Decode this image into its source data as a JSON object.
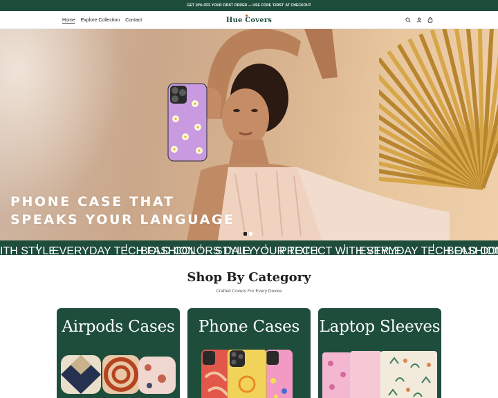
{
  "announcement": {
    "text": "GET 10% OFF YOUR FIRST ORDER — USE CODE 'FIRST' AT CHECKOUT"
  },
  "header": {
    "nav": [
      {
        "label": "Home",
        "active": true
      },
      {
        "label": "Explore Collection",
        "active": false
      },
      {
        "label": "Contact",
        "active": false
      }
    ],
    "logo": "Hue Covers",
    "icons": [
      "search-icon",
      "account-icon",
      "cart-icon"
    ]
  },
  "hero": {
    "title_line1": "PHONE CASE THAT",
    "title_line2": "SPEAKS YOUR LANGUAGE",
    "slides_total": 2,
    "active_slide": 1
  },
  "marquee": {
    "items": [
      "ITH STYLE",
      "EVERYDAY TECH FASHION",
      "BOLD COLORS DAILY",
      "STYLE YOUR TECH",
      "PROTECT WITH STYLE",
      "EVERYDAY TECH FASHION",
      "BOLD COLORS DAILY"
    ]
  },
  "section": {
    "title": "Shop By Category",
    "subtitle": "Crafted Covers For Every Device"
  },
  "categories": [
    {
      "title": "Airpods Cases"
    },
    {
      "title": "Phone Cases"
    },
    {
      "title": "Laptop Sleeves"
    }
  ],
  "colors": {
    "brand_green": "#1e4d3c",
    "logo_accent": "#d8502a",
    "text_dark": "#1f1f1f",
    "hero_bg": "#d9b490"
  }
}
